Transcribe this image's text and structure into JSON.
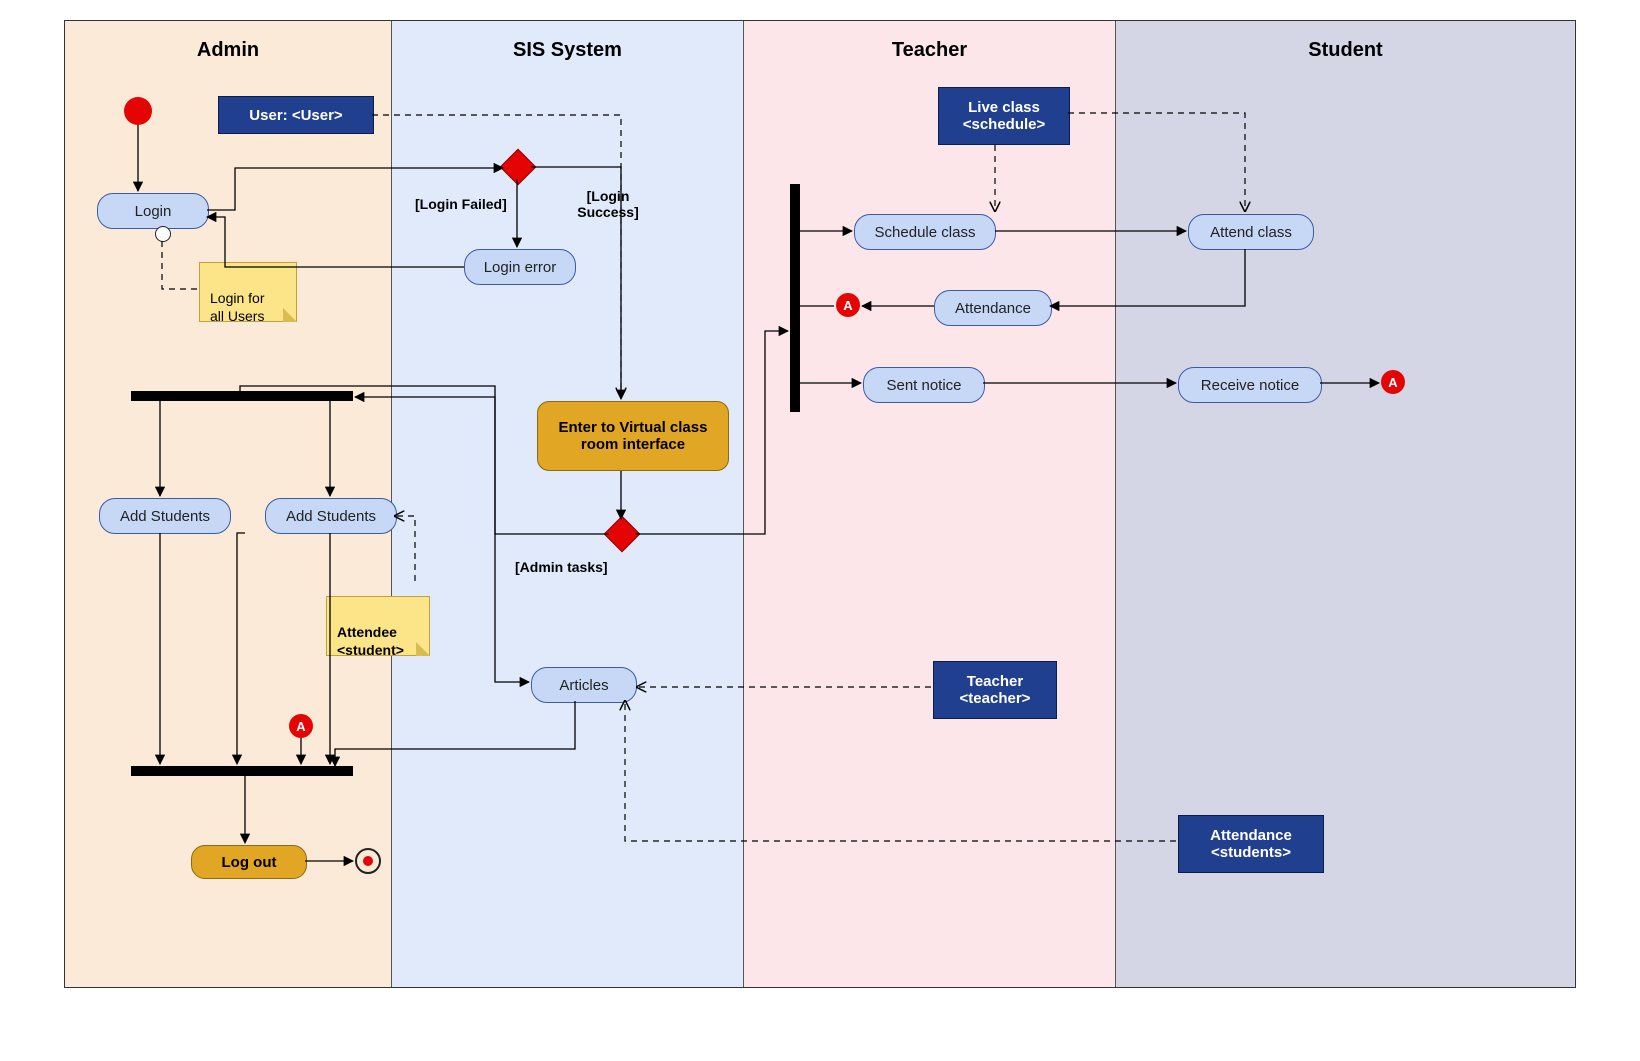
{
  "lanes": {
    "admin": "Admin",
    "sis": "SIS System",
    "teacher": "Teacher",
    "student": "Student"
  },
  "activities": {
    "login": "Login",
    "login_error": "Login error",
    "add_students_left": "Add Students",
    "add_students_right": "Add Students",
    "logout": "Log out",
    "enter_vcr": "Enter to Virtual class\nroom interface",
    "articles": "Articles",
    "schedule_class": "Schedule class",
    "attendance": "Attendance",
    "sent_notice": "Sent notice",
    "attend_class": "Attend class",
    "receive_notice": "Receive notice"
  },
  "datastores": {
    "user": "User: <User>",
    "live_class": "Live class\n<schedule>",
    "teacher_ds": "Teacher\n<teacher>",
    "attendance_students": "Attendance\n<students>"
  },
  "notes": {
    "login_note": "Login for\nall Users",
    "attendee_note": "Attendee\n<student>"
  },
  "guards": {
    "login_failed": "[Login Failed]",
    "login_success": "[Login\nSuccess]",
    "admin_tasks": "[Admin tasks]"
  },
  "refs": {
    "a": "A"
  }
}
